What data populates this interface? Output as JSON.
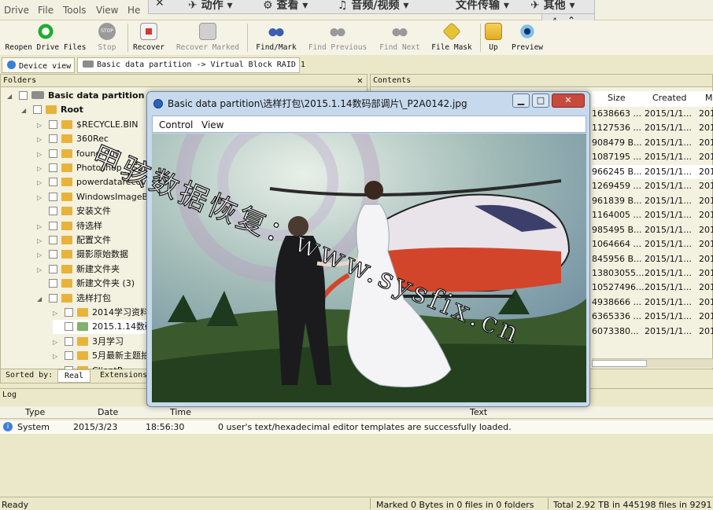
{
  "menu": {
    "drive": "Drive",
    "file": "File",
    "tools": "Tools",
    "view": "View",
    "help": "He"
  },
  "topstrip": {
    "close": "✕",
    "action": "✈ 动作 ▾",
    "view": "⚙ 查看 ▾",
    "av": "♫ 音频/视频 ▾",
    "transfer": "文件传输 ▾",
    "other": "✈ 其他 ▾",
    "expand": "⤢",
    "collapse": "⌃"
  },
  "toolbar": {
    "reopen": "Reopen Drive Files",
    "stop": "Stop",
    "recover": "Recover",
    "recover_marked": "Recover Marked",
    "find_mark": "Find/Mark",
    "find_previous": "Find Previous",
    "find_next": "Find Next",
    "file_mask": "File Mask",
    "up": "Up",
    "preview": "Preview",
    "stop_icon_text": "STOP"
  },
  "tabs": {
    "device_view": "Device view",
    "partition": "Basic data partition -> Virtual Block RAID 1"
  },
  "folders": {
    "header": "Folders",
    "close": "✕",
    "items": [
      {
        "label": "Basic data partition",
        "exp": "◢"
      },
      {
        "label": "Root",
        "exp": "◢"
      },
      {
        "label": "$RECYCLE.BIN",
        "exp": "▷"
      },
      {
        "label": "360Rec",
        "exp": "▷"
      },
      {
        "label": "found.000",
        "exp": "▷"
      },
      {
        "label": "Photoshop_CS3简",
        "exp": "▷"
      },
      {
        "label": "powerdatarecove",
        "exp": "▷"
      },
      {
        "label": "WindowsImageB",
        "exp": "▷"
      },
      {
        "label": "安装文件",
        "exp": ""
      },
      {
        "label": "待选样",
        "exp": "▷"
      },
      {
        "label": "配置文件",
        "exp": "▷"
      },
      {
        "label": "摄影原始数据",
        "exp": "▷"
      },
      {
        "label": "新建文件夹",
        "exp": "▷"
      },
      {
        "label": "新建文件夹 (3)",
        "exp": ""
      },
      {
        "label": "选样打包",
        "exp": "◢"
      },
      {
        "label": "2014学习资料",
        "exp": "▷"
      },
      {
        "label": "2015.1.14数码",
        "exp": ""
      },
      {
        "label": "3月学习",
        "exp": "▷"
      },
      {
        "label": "5月最新主题拍",
        "exp": "▷"
      },
      {
        "label": "ClientP",
        "exp": ""
      }
    ]
  },
  "sortbar": {
    "label": "Sorted by:",
    "real": "Real",
    "extensions": "Extensions"
  },
  "contents": {
    "header": "Contents",
    "columns": {
      "size": "Size",
      "created": "Created",
      "m": "M"
    },
    "rows": [
      {
        "size": "1638663 ...",
        "created": "2015/1/1...",
        "m": "201"
      },
      {
        "size": "1127536 ...",
        "created": "2015/1/1...",
        "m": "201"
      },
      {
        "size": "908479 B...",
        "created": "2015/1/1...",
        "m": "201"
      },
      {
        "size": "1087195 ...",
        "created": "2015/1/1...",
        "m": "201"
      },
      {
        "size": "966245 B...",
        "created": "2015/1/1...",
        "m": "201"
      },
      {
        "size": "1269459 ...",
        "created": "2015/1/1...",
        "m": "201"
      },
      {
        "size": "961839 B...",
        "created": "2015/1/1...",
        "m": "201"
      },
      {
        "size": "1164005 ...",
        "created": "2015/1/1...",
        "m": "201"
      },
      {
        "size": "985495 B...",
        "created": "2015/1/1...",
        "m": "201"
      },
      {
        "size": "1064664 ...",
        "created": "2015/1/1...",
        "m": "201"
      },
      {
        "size": "845956 B...",
        "created": "2015/1/1...",
        "m": "201"
      },
      {
        "size": "13803055...",
        "created": "2015/1/1...",
        "m": "201"
      },
      {
        "size": "10527496...",
        "created": "2015/1/1...",
        "m": "201"
      },
      {
        "size": "4938666 ...",
        "created": "2015/1/1...",
        "m": "201"
      },
      {
        "size": "6365336 ...",
        "created": "2015/1/1...",
        "m": "201"
      },
      {
        "size": "6073380...",
        "created": "2015/1/1...",
        "m": "201"
      }
    ]
  },
  "log": {
    "header": "Log",
    "columns": {
      "type": "Type",
      "date": "Date",
      "time": "Time",
      "text": "Text"
    },
    "row": {
      "type": "System",
      "date": "2015/3/23",
      "time": "18:56:30",
      "text": "0 user's text/hexadecimal editor templates are successfully loaded."
    }
  },
  "status": {
    "ready": "Ready",
    "marked": "Marked 0 Bytes in 0 files in 0 folders",
    "total": "Total 2.92 TB in 445198 files in 9291"
  },
  "viewer": {
    "title": "Basic data partition\\选样打包\\2015.1.14数码部调片\\_P2A0142.jpg",
    "menu": {
      "control": "Control",
      "view": "View"
    },
    "btns": {
      "min": "▁",
      "max": "□",
      "close": "✕"
    },
    "watermark": "甲骇数据恢复：www.sysfix.cn"
  }
}
